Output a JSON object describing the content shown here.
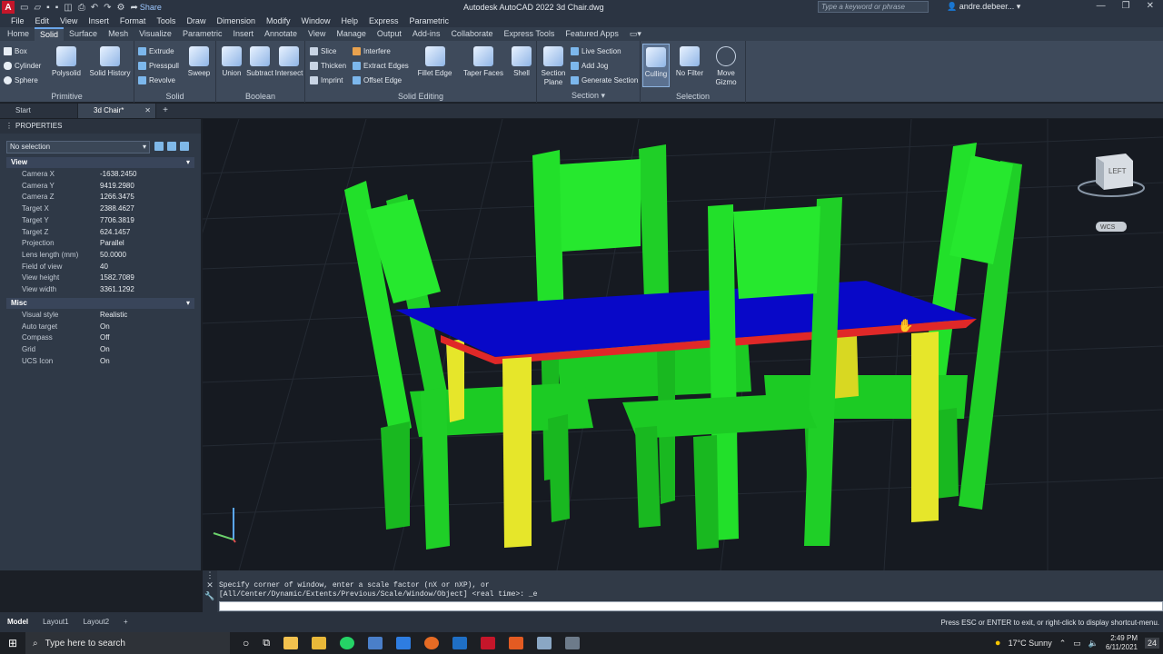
{
  "app": {
    "title": "Autodesk AutoCAD 2022   3d Chair.dwg",
    "share_label": "Share",
    "search_placeholder": "Type a keyword or phrase",
    "user": "andre.debeer...",
    "logo": "A"
  },
  "menubar": [
    "File",
    "Edit",
    "View",
    "Insert",
    "Format",
    "Tools",
    "Draw",
    "Dimension",
    "Modify",
    "Window",
    "Help",
    "Express",
    "Parametric"
  ],
  "ribbon_tabs": [
    "Home",
    "Solid",
    "Surface",
    "Mesh",
    "Visualize",
    "Parametric",
    "Insert",
    "Annotate",
    "View",
    "Manage",
    "Output",
    "Add-ins",
    "Collaborate",
    "Express Tools",
    "Featured Apps"
  ],
  "ribbon": {
    "primitive": {
      "title": "Primitive",
      "box": "Box",
      "cylinder": "Cylinder",
      "sphere": "Sphere",
      "polysolid": "Polysolid",
      "solid_history": "Solid History"
    },
    "solid": {
      "title": "Solid",
      "extrude": "Extrude",
      "presspull": "Presspull",
      "revolve": "Revolve",
      "sweep": "Sweep"
    },
    "boolean": {
      "title": "Boolean",
      "union": "Union",
      "subtract": "Subtract",
      "intersect": "Intersect"
    },
    "solid_editing": {
      "title": "Solid Editing",
      "slice": "Slice",
      "thicken": "Thicken",
      "imprint": "Imprint",
      "interfere": "Interfere",
      "extract_edges": "Extract Edges",
      "offset_edge": "Offset Edge",
      "fillet_edge": "Fillet Edge",
      "taper_faces": "Taper Faces",
      "shell": "Shell"
    },
    "section": {
      "title": "Section",
      "section_plane_1": "Section",
      "section_plane_2": "Plane",
      "live_section": "Live Section",
      "add_jog": "Add Jog",
      "generate_section": "Generate Section"
    },
    "selection": {
      "title": "Selection",
      "culling": "Culling",
      "no_filter": "No Filter",
      "move_gizmo_1": "Move",
      "move_gizmo_2": "Gizmo"
    }
  },
  "doc_tabs": {
    "start": "Start",
    "active": "3d Chair*"
  },
  "properties": {
    "title": "PROPERTIES",
    "selection": "No selection",
    "view_section": "View",
    "view_rows": [
      {
        "k": "Camera X",
        "v": "-1638.2450"
      },
      {
        "k": "Camera Y",
        "v": "9419.2980"
      },
      {
        "k": "Camera Z",
        "v": "1266.3475"
      },
      {
        "k": "Target X",
        "v": "2388.4627"
      },
      {
        "k": "Target Y",
        "v": "7706.3819"
      },
      {
        "k": "Target Z",
        "v": "624.1457"
      },
      {
        "k": "Projection",
        "v": "Parallel"
      },
      {
        "k": "Lens length (mm)",
        "v": "50.0000"
      },
      {
        "k": "Field of view",
        "v": "40"
      },
      {
        "k": "View height",
        "v": "1582.7089"
      },
      {
        "k": "View width",
        "v": "3361.1292"
      }
    ],
    "misc_section": "Misc",
    "misc_rows": [
      {
        "k": "Visual style",
        "v": "Realistic"
      },
      {
        "k": "Auto target",
        "v": "On"
      },
      {
        "k": "Compass",
        "v": "Off"
      },
      {
        "k": "Grid",
        "v": "On"
      },
      {
        "k": "UCS Icon",
        "v": "On"
      }
    ]
  },
  "viewcube": {
    "face": "LEFT",
    "wcs": "WCS"
  },
  "command": {
    "line1": "Specify corner of window, enter a scale factor (nX or nXP), or",
    "line2": "[All/Center/Dynamic/Extents/Previous/Scale/Window/Object] <real time>: _e"
  },
  "layouts": [
    "Model",
    "Layout1",
    "Layout2"
  ],
  "status_message": "Press ESC or ENTER to exit, or right-click to display shortcut-menu.",
  "taskbar": {
    "search": "Type here to search",
    "weather": "17°C  Sunny",
    "time": "2:49 PM",
    "date": "6/11/2021",
    "notif_count": "24"
  },
  "colors": {
    "chair": "#22e02a",
    "table_top": "#0808c8",
    "table_edge": "#e02828",
    "table_legs": "#e6e62a"
  }
}
